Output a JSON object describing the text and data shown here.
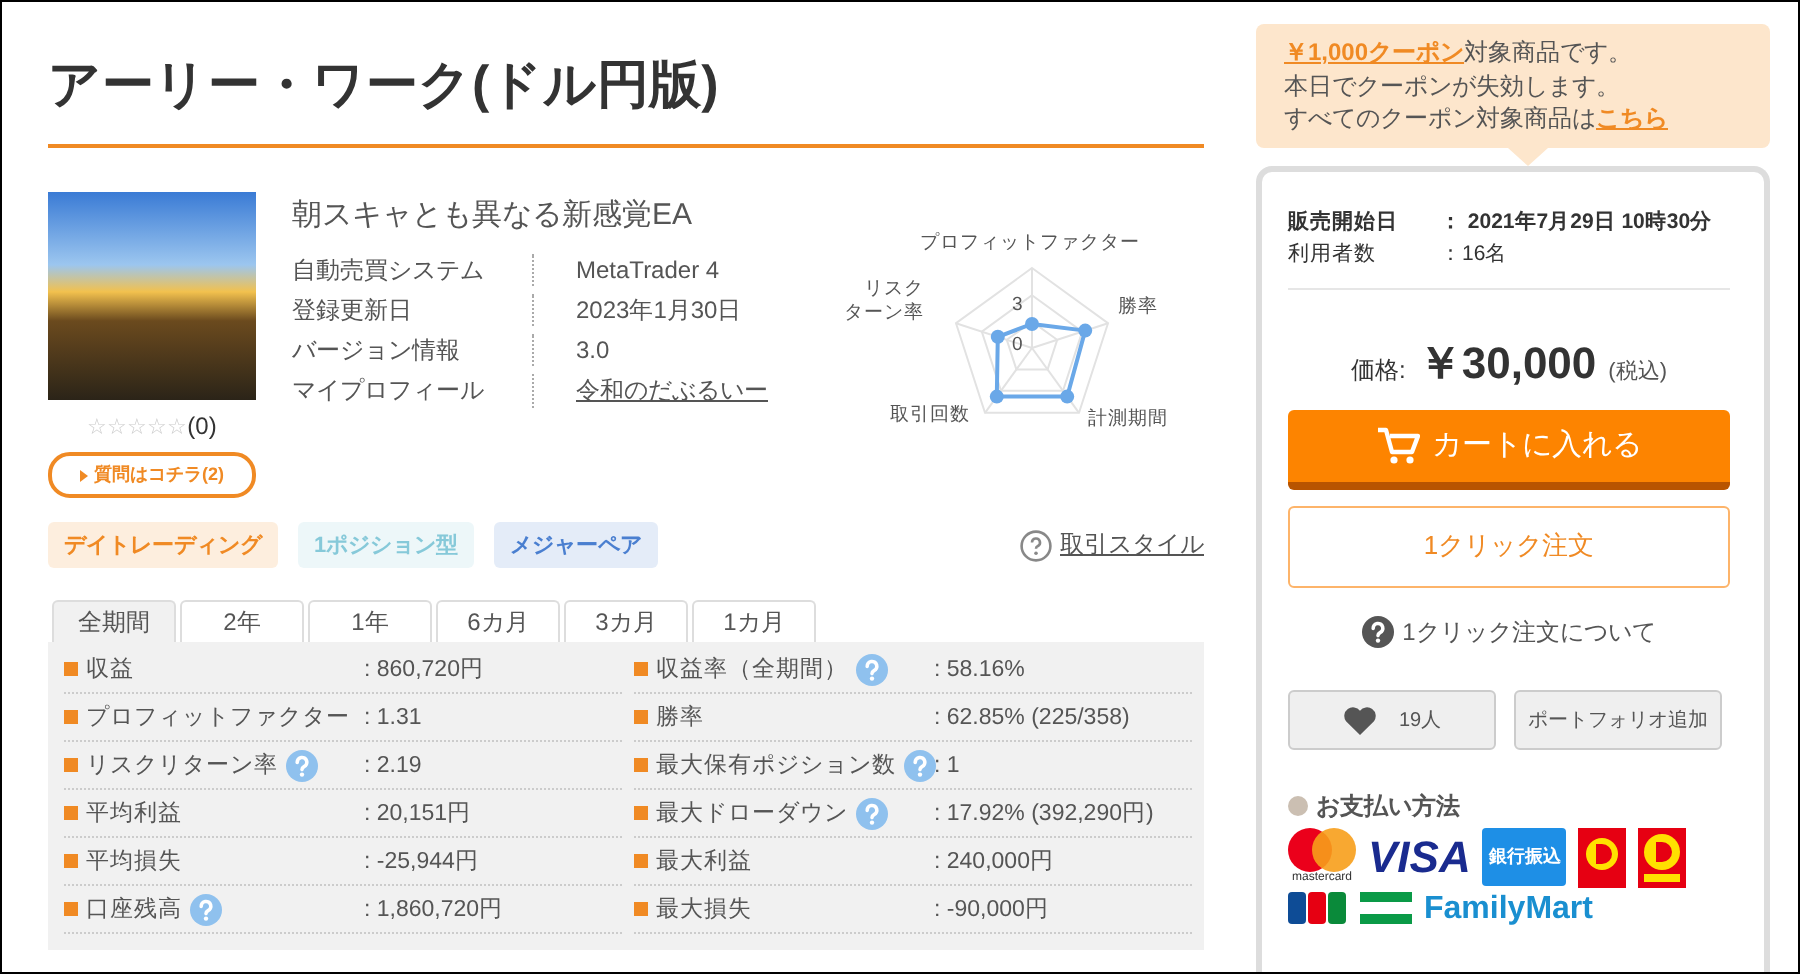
{
  "title": "アーリー・ワーク(ドル円版)",
  "product": {
    "stars": 0,
    "review_count": "(0)",
    "question_button": "質問はコチラ(2)",
    "tagline": "朝スキャとも異なる新感覚EA",
    "info": [
      {
        "label": "自動売買システム",
        "value": "MetaTrader 4",
        "kind": "text"
      },
      {
        "label": "登録更新日",
        "value": "2023年1月30日",
        "kind": "text"
      },
      {
        "label": "バージョン情報",
        "value": "3.0",
        "kind": "text"
      },
      {
        "label": "マイプロフィール",
        "value": "令和のだぶるいー",
        "kind": "link"
      }
    ],
    "radar": {
      "axis_labels": [
        [
          "プロフィットファクター"
        ],
        [
          "リスク",
          "ターン率"
        ],
        [
          "勝率"
        ],
        [
          "取引回数"
        ],
        [
          "計測期間"
        ]
      ],
      "ticks": [
        "3",
        "0"
      ]
    },
    "tags": [
      {
        "label": "デイトレーディング",
        "color": "#f08a24"
      },
      {
        "label": "1ポジション型",
        "color": "#86c9d9"
      },
      {
        "label": "メジャーペア",
        "color": "#4a7fd0"
      }
    ],
    "trade_style_link": "取引スタイル"
  },
  "periods": [
    {
      "label": "全期間",
      "selected": true
    },
    {
      "label": "2年",
      "selected": false
    },
    {
      "label": "1年",
      "selected": false
    },
    {
      "label": "6カ月",
      "selected": false
    },
    {
      "label": "3カ月",
      "selected": false
    },
    {
      "label": "1カ月",
      "selected": false
    }
  ],
  "stats": {
    "column_1": [
      {
        "label": "収益",
        "value": ": 860,720円",
        "help": false
      },
      {
        "label": "プロフィットファクター",
        "value": ": 1.31",
        "help": false
      },
      {
        "label": "リスクリターン率",
        "value": ": 2.19",
        "help": true
      },
      {
        "label": "平均利益",
        "value": ": 20,151円",
        "help": false
      },
      {
        "label": "平均損失",
        "value": ": -25,944円",
        "help": false
      },
      {
        "label": "口座残高",
        "value": ": 1,860,720円",
        "help": true
      }
    ],
    "column_2": [
      {
        "label": "収益率（全期間）",
        "value": ": 58.16%",
        "help": true
      },
      {
        "label": "勝率",
        "value": ": 62.85% (225/358)",
        "help": false
      },
      {
        "label": "最大保有ポジション数",
        "value": ": 1",
        "help": true
      },
      {
        "label": "最大ドローダウン",
        "value": ": 17.92% (392,290円)",
        "help": true
      },
      {
        "label": "最大利益",
        "value": ": 240,000円",
        "help": false
      },
      {
        "label": "最大損失",
        "value": ": -90,000円",
        "help": false
      }
    ]
  },
  "coupon": {
    "link_1": "￥1,000クーポン",
    "text_1": "対象商品です。",
    "text_2": "本日でクーポンが失効します。",
    "text_3": "すべてのクーポン対象商品は",
    "link_2": "こちら"
  },
  "sale": [
    {
      "label": "販売開始日",
      "value": "： 2021年7月29日 10時30分",
      "emphasized": true
    },
    {
      "label": "利用者数",
      "value": "：16名",
      "emphasized": false
    }
  ],
  "price": {
    "label": "価格:",
    "amount": "￥30,000",
    "tax": "(税込)"
  },
  "cart_button": "カートに入れる",
  "one_click_button": "1クリック注文",
  "one_click_help": "1クリック注文について",
  "favorite_count": "19人",
  "portfolio_button": "ポートフォリオ追加",
  "payment": {
    "title": "お支払い方法",
    "methods": [
      {
        "kind": "mastercard",
        "text": "mastercard"
      },
      {
        "kind": "visa",
        "text": "VISA"
      },
      {
        "kind": "bank",
        "text": "銀行振込"
      },
      {
        "kind": "d-point"
      },
      {
        "kind": "daily"
      },
      {
        "kind": "jcb"
      },
      {
        "kind": "familymart",
        "text": "FamilyMart"
      }
    ]
  }
}
